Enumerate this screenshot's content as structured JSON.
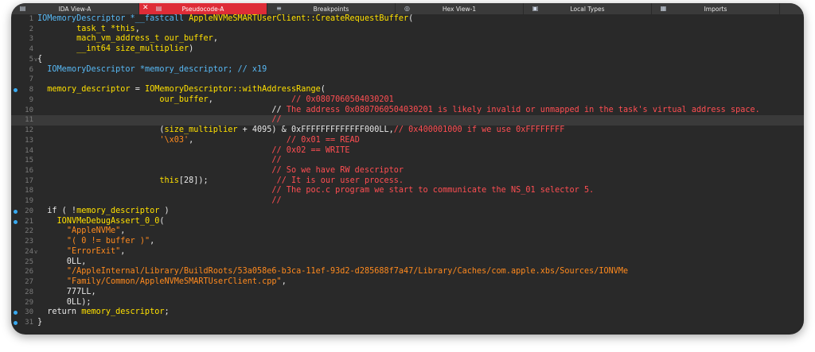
{
  "tabs": [
    {
      "label": "IDA View-A",
      "icon": "ida-view-icon",
      "active": false
    },
    {
      "label": "Pseudocode-A",
      "icon": "pseudocode-icon",
      "active": true,
      "closable": true
    },
    {
      "label": "Breakpoints",
      "icon": "breakpoints-icon",
      "active": false
    },
    {
      "label": "Hex View-1",
      "icon": "hex-view-icon",
      "active": false
    },
    {
      "label": "Local Types",
      "icon": "local-types-icon",
      "active": false
    },
    {
      "label": "Imports",
      "icon": "imports-icon",
      "active": false
    }
  ],
  "colors": {
    "background": "#292929",
    "keyword": "#e9e9e9",
    "function": "#ffe000",
    "type": "#58b9f5",
    "comment": "#ff4e52",
    "string": "#ff8a1e",
    "breakpoint": "#39a9ef",
    "active_tab": "#de2c37"
  },
  "code": {
    "lines": [
      {
        "n": "1",
        "bp": false,
        "fold": "",
        "segs": [
          [
            "ty",
            "IOMemoryDescriptor *__fastcall "
          ],
          [
            "fn",
            "AppleNVMeSMARTUserClient::CreateRequestBuffer"
          ],
          [
            "kw",
            "("
          ]
        ]
      },
      {
        "n": "2",
        "bp": false,
        "fold": "",
        "segs": [
          [
            "kw",
            "        "
          ],
          [
            "fn",
            "task_t *this"
          ],
          [
            "kw",
            ","
          ]
        ]
      },
      {
        "n": "3",
        "bp": false,
        "fold": "",
        "segs": [
          [
            "kw",
            "        "
          ],
          [
            "fn",
            "mach_vm_address_t our_buffer"
          ],
          [
            "kw",
            ","
          ]
        ]
      },
      {
        "n": "4",
        "bp": false,
        "fold": "",
        "segs": [
          [
            "kw",
            "        "
          ],
          [
            "fn",
            "__int64 size_multiplier"
          ],
          [
            "kw",
            ")"
          ]
        ]
      },
      {
        "n": "5",
        "bp": false,
        "fold": "v",
        "segs": [
          [
            "kw",
            "{"
          ]
        ]
      },
      {
        "n": "6",
        "bp": false,
        "fold": "",
        "segs": [
          [
            "kw",
            "  "
          ],
          [
            "ty",
            "IOMemoryDescriptor *memory_descriptor; // x19"
          ]
        ]
      },
      {
        "n": "7",
        "bp": false,
        "fold": "",
        "segs": []
      },
      {
        "n": "8",
        "bp": true,
        "fold": "",
        "segs": [
          [
            "kw",
            "  "
          ],
          [
            "fn",
            "memory_descriptor"
          ],
          [
            "kw",
            " = "
          ],
          [
            "fn",
            "IOMemoryDescriptor::withAddressRange"
          ],
          [
            "kw",
            "("
          ]
        ]
      },
      {
        "n": "9",
        "bp": false,
        "fold": "",
        "segs": [
          [
            "kw",
            "                         "
          ],
          [
            "fn",
            "our_buffer"
          ],
          [
            "kw",
            ",                "
          ],
          [
            "cm",
            "// 0x0807060504030201"
          ]
        ]
      },
      {
        "n": "10",
        "bp": false,
        "fold": "",
        "segs": [
          [
            "kw",
            "                                                // "
          ],
          [
            "cm",
            "The address 0x0807060504030201 is likely invalid or unmapped in the task's virtual address space."
          ]
        ]
      },
      {
        "n": "11",
        "bp": false,
        "fold": "",
        "hl": true,
        "segs": [
          [
            "kw",
            "                                                "
          ],
          [
            "cm",
            "//"
          ]
        ]
      },
      {
        "n": "12",
        "bp": false,
        "fold": "",
        "segs": [
          [
            "kw",
            "                         ("
          ],
          [
            "fn",
            "size_multiplier"
          ],
          [
            "kw",
            " + 4095) & 0xFFFFFFFFFFFFF000LL,"
          ],
          [
            "cm",
            "// 0x400001000 if we use 0xFFFFFFFF"
          ]
        ]
      },
      {
        "n": "13",
        "bp": false,
        "fold": "",
        "segs": [
          [
            "kw",
            "                         "
          ],
          [
            "st",
            "'\\x03'"
          ],
          [
            "kw",
            ",                   "
          ],
          [
            "cm",
            "// 0x01 == READ"
          ]
        ]
      },
      {
        "n": "14",
        "bp": false,
        "fold": "",
        "segs": [
          [
            "kw",
            "                                                "
          ],
          [
            "cm",
            "// 0x02 == WRITE"
          ]
        ]
      },
      {
        "n": "15",
        "bp": false,
        "fold": "",
        "segs": [
          [
            "kw",
            "                                                "
          ],
          [
            "cm",
            "//"
          ]
        ]
      },
      {
        "n": "16",
        "bp": false,
        "fold": "",
        "segs": [
          [
            "kw",
            "                                                "
          ],
          [
            "cm",
            "// So we have RW descriptor"
          ]
        ]
      },
      {
        "n": "17",
        "bp": false,
        "fold": "",
        "segs": [
          [
            "kw",
            "                         "
          ],
          [
            "fn",
            "this"
          ],
          [
            "kw",
            "[28]);              "
          ],
          [
            "cm",
            "// It is our user process."
          ]
        ]
      },
      {
        "n": "18",
        "bp": false,
        "fold": "",
        "segs": [
          [
            "kw",
            "                                                "
          ],
          [
            "cm",
            "// The poc.c program we start to communicate the NS_01 selector 5."
          ]
        ]
      },
      {
        "n": "19",
        "bp": false,
        "fold": "",
        "segs": [
          [
            "kw",
            "                                                "
          ],
          [
            "cm",
            "//"
          ]
        ]
      },
      {
        "n": "20",
        "bp": true,
        "fold": "",
        "segs": [
          [
            "kw",
            "  if ( !"
          ],
          [
            "fn",
            "memory_descriptor"
          ],
          [
            "kw",
            " )"
          ]
        ]
      },
      {
        "n": "21",
        "bp": true,
        "fold": "",
        "segs": [
          [
            "kw",
            "    "
          ],
          [
            "fn",
            "IONVMeDebugAssert_0_0"
          ],
          [
            "kw",
            "("
          ]
        ]
      },
      {
        "n": "22",
        "bp": false,
        "fold": "",
        "segs": [
          [
            "kw",
            "      "
          ],
          [
            "st",
            "\"AppleNVMe\""
          ],
          [
            "kw",
            ","
          ]
        ]
      },
      {
        "n": "23",
        "bp": false,
        "fold": "",
        "segs": [
          [
            "kw",
            "      "
          ],
          [
            "st",
            "\"( 0 != buffer )\""
          ],
          [
            "kw",
            ","
          ]
        ]
      },
      {
        "n": "24",
        "bp": false,
        "fold": "v",
        "segs": [
          [
            "kw",
            "      "
          ],
          [
            "st",
            "\"ErrorExit\""
          ],
          [
            "kw",
            ","
          ]
        ]
      },
      {
        "n": "25",
        "bp": false,
        "fold": "",
        "segs": [
          [
            "kw",
            "      0LL,"
          ]
        ]
      },
      {
        "n": "26",
        "bp": false,
        "fold": "",
        "segs": [
          [
            "kw",
            "      "
          ],
          [
            "st",
            "\"/AppleInternal/Library/BuildRoots/53a058e6-b3ca-11ef-93d2-d285688f7a47/Library/Caches/com.apple.xbs/Sources/IONVMe"
          ]
        ]
      },
      {
        "n": "27",
        "bp": false,
        "fold": "",
        "segs": [
          [
            "kw",
            "      "
          ],
          [
            "st",
            "\"Family/Common/AppleNVMeSMARTUserClient.cpp\""
          ],
          [
            "kw",
            ","
          ]
        ]
      },
      {
        "n": "28",
        "bp": false,
        "fold": "",
        "segs": [
          [
            "kw",
            "      777LL,"
          ]
        ]
      },
      {
        "n": "29",
        "bp": false,
        "fold": "",
        "segs": [
          [
            "kw",
            "      0LL);"
          ]
        ]
      },
      {
        "n": "30",
        "bp": true,
        "fold": "",
        "segs": [
          [
            "kw",
            "  return "
          ],
          [
            "fn",
            "memory_descriptor"
          ],
          [
            "kw",
            ";"
          ]
        ]
      },
      {
        "n": "31",
        "bp": true,
        "fold": "",
        "segs": [
          [
            "kw",
            "}"
          ]
        ]
      }
    ]
  }
}
